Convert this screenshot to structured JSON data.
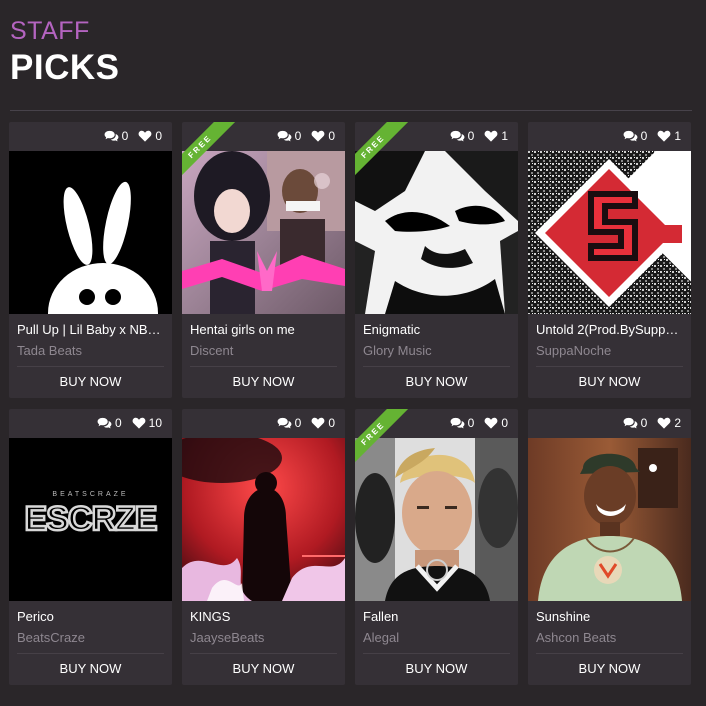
{
  "header": {
    "staff_label": "STAFF",
    "picks_label": "PICKS"
  },
  "colors": {
    "accent": "#b464c0",
    "free_ribbon": "#65b333",
    "background": "#2a2629",
    "card": "#353036"
  },
  "cards": [
    {
      "title": "Pull Up | Lil Baby x NB…",
      "author": "Tada Beats",
      "comments": "0",
      "likes": "0",
      "free": false,
      "ribbon_label": "",
      "buy_label": "BUY NOW",
      "art": "white-bunny-on-black"
    },
    {
      "title": "Hentai girls on me",
      "author": "Discent",
      "comments": "0",
      "likes": "0",
      "free": true,
      "ribbon_label": "FREE",
      "buy_label": "BUY NOW",
      "art": "anime-collage-pink"
    },
    {
      "title": "Enigmatic",
      "author": "Glory Music",
      "comments": "0",
      "likes": "1",
      "free": true,
      "ribbon_label": "FREE",
      "buy_label": "BUY NOW",
      "art": "black-white-face-sketch"
    },
    {
      "title": "Untold 2(Prod.BySupp…",
      "author": "SuppaNoche",
      "comments": "0",
      "likes": "1",
      "free": false,
      "ribbon_label": "",
      "buy_label": "BUY NOW",
      "art": "red-s-logo-noise"
    },
    {
      "title": "Perico",
      "author": "BeatsCraze",
      "comments": "0",
      "likes": "10",
      "free": false,
      "ribbon_label": "",
      "buy_label": "BUY NOW",
      "art": "beatscraze-logo"
    },
    {
      "title": "KINGS",
      "author": "JaayseBeats",
      "comments": "0",
      "likes": "0",
      "free": false,
      "ribbon_label": "",
      "buy_label": "BUY NOW",
      "art": "red-silhouette-fire"
    },
    {
      "title": "Fallen",
      "author": "Alegal",
      "comments": "0",
      "likes": "0",
      "free": true,
      "ribbon_label": "FREE",
      "buy_label": "BUY NOW",
      "art": "portrait-blond-hair"
    },
    {
      "title": "Sunshine",
      "author": "Ashcon Beats",
      "comments": "0",
      "likes": "2",
      "free": false,
      "ribbon_label": "",
      "buy_label": "BUY NOW",
      "art": "smiling-man-cap"
    }
  ],
  "art_text": {
    "beatscraze_small": "BEATSCRAZE",
    "beatscraze_big": "ESCRZE"
  }
}
